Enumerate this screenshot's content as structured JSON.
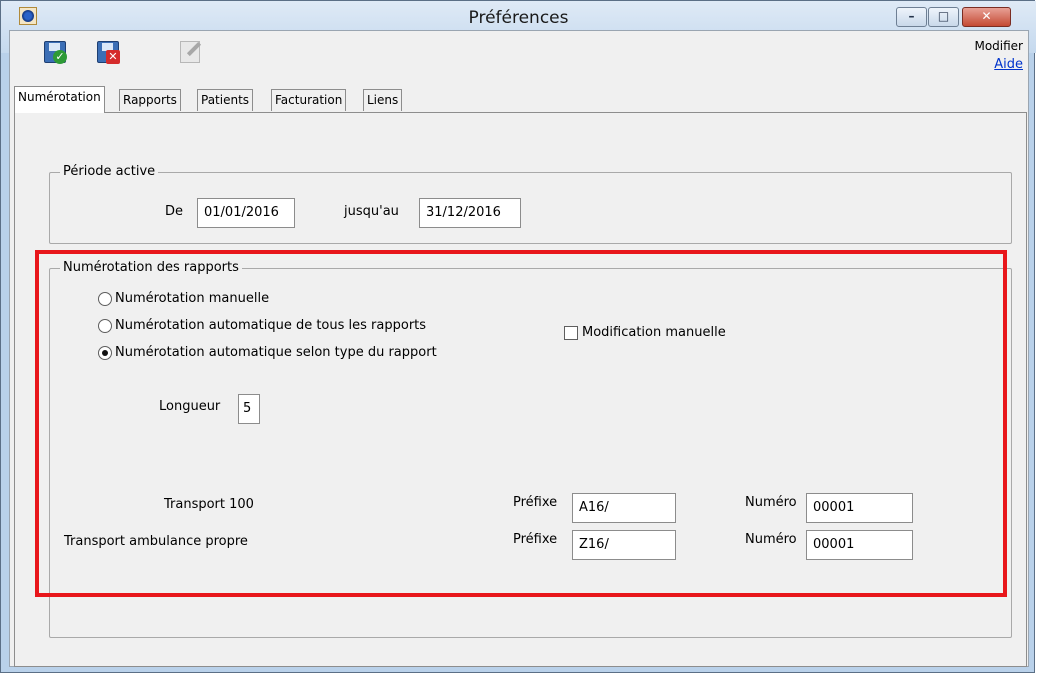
{
  "window": {
    "title": "Préférences",
    "controls": {
      "minimize": "–",
      "maximize": "□",
      "close": "✕"
    }
  },
  "toolbar": {
    "save_icon": "save-icon",
    "cancel_icon": "cancel-icon",
    "edit_icon": "edit-icon",
    "modifier_label": "Modifier",
    "aide_link": "Aide"
  },
  "tabs": [
    {
      "label": "Numérotation",
      "active": true
    },
    {
      "label": "Rapports",
      "active": false
    },
    {
      "label": "Patients",
      "active": false
    },
    {
      "label": "Facturation",
      "active": false
    },
    {
      "label": "Liens",
      "active": false
    }
  ],
  "periode": {
    "legend": "Période active",
    "de_label": "De",
    "de_value": "01/01/2016",
    "jusquau_label": "jusqu'au",
    "jusquau_value": "31/12/2016"
  },
  "numerotation": {
    "legend": "Numérotation des rapports",
    "options": [
      {
        "label": "Numérotation manuelle",
        "selected": false
      },
      {
        "label": "Numérotation automatique de tous les rapports",
        "selected": false
      },
      {
        "label": "Numérotation automatique selon type du rapport",
        "selected": true
      }
    ],
    "modification_manuelle": {
      "label": "Modification manuelle",
      "checked": false
    },
    "longueur_label": "Longueur",
    "longueur_value": "5",
    "rows": [
      {
        "type": "Transport 100",
        "prefixe_label": "Préfixe",
        "prefixe_value": "A16/",
        "numero_label": "Numéro",
        "numero_value": "00001"
      },
      {
        "type": "Transport ambulance propre",
        "prefixe_label": "Préfixe",
        "prefixe_value": "Z16/",
        "numero_label": "Numéro",
        "numero_value": "00001"
      }
    ]
  },
  "colors": {
    "highlight": "#e8161b",
    "window_frame": "#b9d1ea",
    "client_bg": "#f0f0f0",
    "link": "#0033cc"
  }
}
